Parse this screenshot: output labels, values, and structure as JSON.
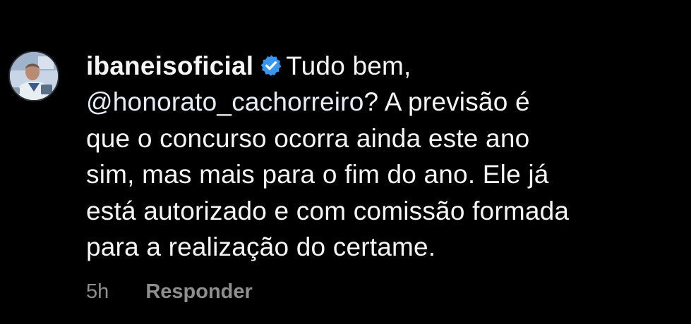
{
  "comment": {
    "username": "ibaneisoficial",
    "verified_icon": "verified-badge-icon",
    "greeting": "Tudo bem,",
    "mention": "@honorato_cachorreiro",
    "line2_rest": "? A previsão é",
    "line3": "que o concurso ocorra ainda este ano",
    "line4": "sim, mas mais para o fim do ano. Ele já",
    "line5": "está autorizado e com comissão formada",
    "line6": "para a realização do certame.",
    "timestamp": "5h",
    "reply_label": "Responder"
  },
  "colors": {
    "background": "#000000",
    "text": "#f5f5f5",
    "meta": "#8e8e8e",
    "verified_badge": "#3897f0"
  }
}
